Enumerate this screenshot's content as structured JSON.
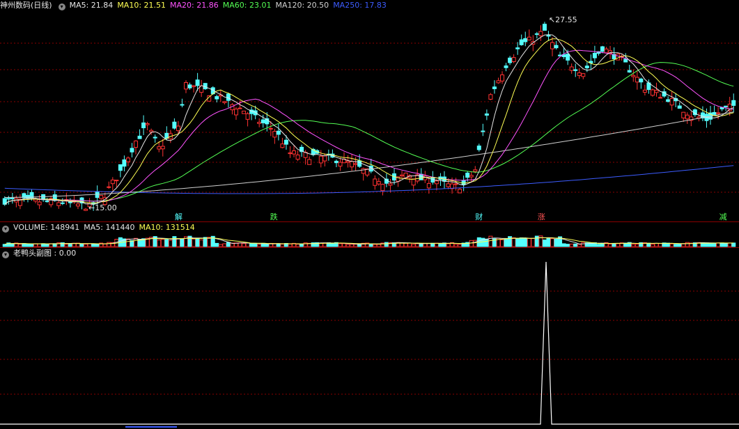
{
  "main_panel": {
    "title": "神州数码(日线)",
    "indicators": [
      {
        "label": "MA5:",
        "value": "21.84",
        "color": "#e6e6e6"
      },
      {
        "label": "MA10:",
        "value": "21.51",
        "color": "#ffff54"
      },
      {
        "label": "MA20:",
        "value": "21.86",
        "color": "#ff54ff"
      },
      {
        "label": "MA60:",
        "value": "23.01",
        "color": "#54ff54"
      },
      {
        "label": "MA120:",
        "value": "20.50",
        "color": "#d0d0d0"
      },
      {
        "label": "MA250:",
        "value": "17.83",
        "color": "#3c5cff"
      }
    ],
    "high_label": "27.55",
    "low_label": "15.00",
    "markers": [
      {
        "text": "解",
        "color": "#54ffff",
        "x_frac": 0.24
      },
      {
        "text": "跌",
        "color": "#54ff54",
        "x_frac": 0.37
      },
      {
        "text": "财",
        "color": "#54ffff",
        "x_frac": 0.65
      },
      {
        "text": "涨",
        "color": "#ff5454",
        "x_frac": 0.735
      },
      {
        "text": "减",
        "color": "#54ff54",
        "x_frac": 0.983
      }
    ]
  },
  "volume_panel": {
    "title": "VOLUME: 148941",
    "ma5_label": "MA5: 141440",
    "ma10_label": "MA10: 131514",
    "colors": {
      "ma5": "#e6e6e6",
      "ma10": "#ffff54"
    }
  },
  "sub_panel": {
    "title": "老鸭头副图 : 0.00"
  },
  "colors": {
    "up": "#ff3232",
    "down": "#54ffff",
    "grid": "#8b0000"
  }
}
